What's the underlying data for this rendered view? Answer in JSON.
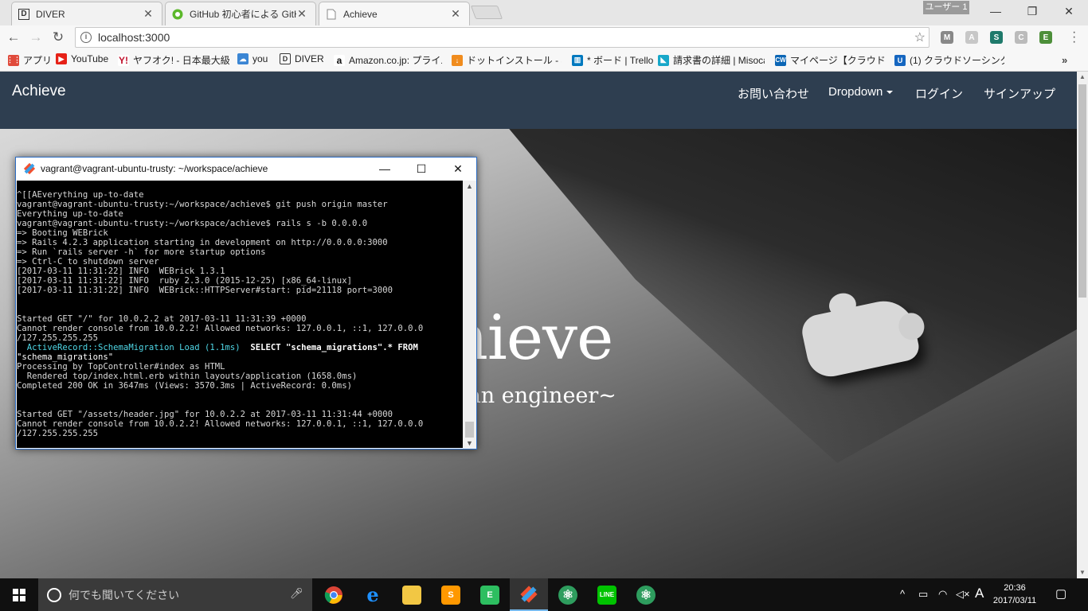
{
  "browser": {
    "tabs": [
      {
        "title": "DIVER",
        "favicon": "D"
      },
      {
        "title": "GitHub 初心者による GitH",
        "favicon": ""
      },
      {
        "title": "Achieve",
        "favicon": ""
      }
    ],
    "user_badge": "ユーザー 1",
    "url": "localhost:3000",
    "bookmarks": [
      {
        "label": "アプリ",
        "icon": "apps-icon",
        "color": "#e04a3b"
      },
      {
        "label": "YouTube",
        "icon": "youtube-icon",
        "color": "#e62117"
      },
      {
        "label": "ヤフオク! - 日本最大級の",
        "icon": "yahoo-icon",
        "color": "#c0102b"
      },
      {
        "label": "you",
        "icon": "cloud-icon",
        "color": "#3b86d4"
      },
      {
        "label": "DIVER",
        "icon": "diver-icon",
        "color": "#333333"
      },
      {
        "label": "Amazon.co.jp: プライム",
        "icon": "amazon-icon",
        "color": "#111111"
      },
      {
        "label": "ドットインストール - 3分動",
        "icon": "dotinstall-icon",
        "color": "#f08c1e"
      },
      {
        "label": "* ボード | Trello",
        "icon": "trello-icon",
        "color": "#0079bf"
      },
      {
        "label": "請求書の詳細 | Misoca",
        "icon": "misoca-icon",
        "color": "#17a7c9"
      },
      {
        "label": "マイページ【クラウドワーク",
        "icon": "crowdworks-icon",
        "color": "#0b66b5"
      },
      {
        "label": "(1) クラウドソーシングなら",
        "icon": "lancers-icon",
        "color": "#1566c0"
      }
    ]
  },
  "site": {
    "brand": "Achieve",
    "nav": {
      "contact": "お問い合わせ",
      "dropdown": "Dropdown",
      "login": "ログイン",
      "signup": "サインアップ"
    },
    "hero_title": "chieve",
    "hero_subtitle": "ll be an engineer~"
  },
  "terminal": {
    "title": "vagrant@vagrant-ubuntu-trusty: ~/workspace/achieve",
    "lines": [
      "^[[AEverything up-to-date",
      "vagrant@vagrant-ubuntu-trusty:~/workspace/achieve$ git push origin master",
      "Everything up-to-date",
      "vagrant@vagrant-ubuntu-trusty:~/workspace/achieve$ rails s -b 0.0.0.0",
      "=> Booting WEBrick",
      "=> Rails 4.2.3 application starting in development on http://0.0.0.0:3000",
      "=> Run `rails server -h` for more startup options",
      "=> Ctrl-C to shutdown server",
      "[2017-03-11 11:31:22] INFO  WEBrick 1.3.1",
      "[2017-03-11 11:31:22] INFO  ruby 2.3.0 (2015-12-25) [x86_64-linux]",
      "[2017-03-11 11:31:22] INFO  WEBrick::HTTPServer#start: pid=21118 port=3000",
      "",
      "",
      "Started GET \"/\" for 10.0.2.2 at 2017-03-11 11:31:39 +0000",
      "Cannot render console from 10.0.2.2! Allowed networks: 127.0.0.1, ::1, 127.0.0.0",
      "/127.255.255.255",
      "__AR__",
      "\"schema_migrations\"",
      "Processing by TopController#index as HTML",
      "  Rendered top/index.html.erb within layouts/application (1658.0ms)",
      "Completed 200 OK in 3647ms (Views: 3570.3ms | ActiveRecord: 0.0ms)",
      "",
      "",
      "Started GET \"/assets/header.jpg\" for 10.0.2.2 at 2017-03-11 11:31:44 +0000",
      "Cannot render console from 10.0.2.2! Allowed networks: 127.0.0.1, ::1, 127.0.0.0",
      "/127.255.255.255"
    ],
    "ar_line": {
      "label": "  ActiveRecord::SchemaMigration Load (1.1ms)",
      "sql": "  SELECT \"schema_migrations\".* FROM"
    }
  },
  "taskbar": {
    "search_placeholder": "何でも聞いてください",
    "ime": "A",
    "time": "20:36",
    "date": "2017/03/11"
  }
}
